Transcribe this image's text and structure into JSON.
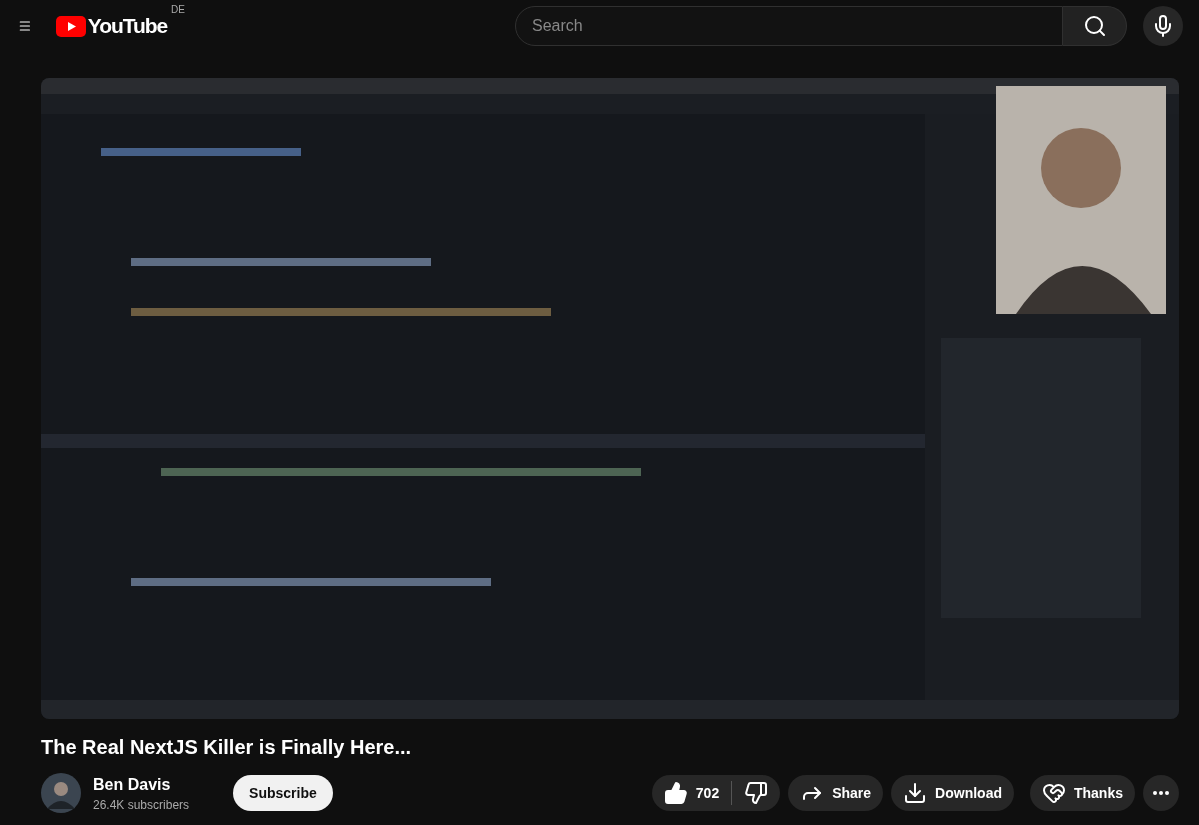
{
  "header": {
    "logo_text": "YouTube",
    "country_code": "DE",
    "search": {
      "placeholder": "Search"
    }
  },
  "title": "The Real NextJS Killer is Finally Here...",
  "channel": {
    "name": "Ben Davis",
    "subscribers": "26.4K subscribers",
    "subscribe_label": "Subscribe"
  },
  "actions": {
    "likes": "702",
    "share": "Share",
    "download": "Download",
    "thanks": "Thanks"
  }
}
